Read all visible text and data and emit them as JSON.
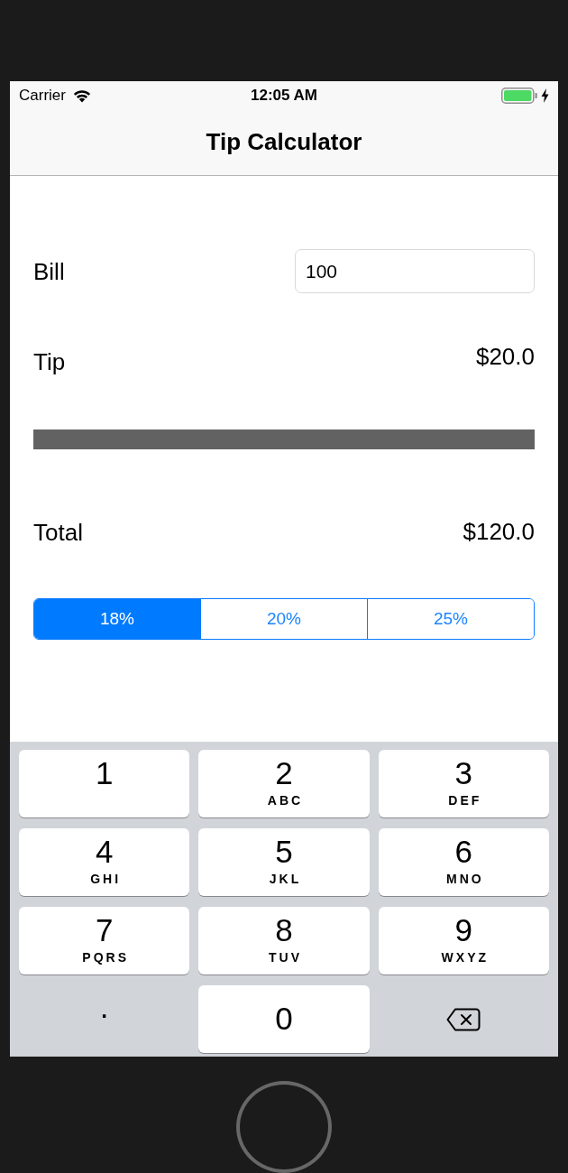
{
  "status_bar": {
    "carrier": "Carrier",
    "time": "12:05 AM",
    "charging": true
  },
  "nav_bar": {
    "title": "Tip Calculator"
  },
  "bill": {
    "label": "Bill",
    "value": "100"
  },
  "tip": {
    "label": "Tip",
    "amount": "$20.0"
  },
  "total": {
    "label": "Total",
    "amount": "$120.0"
  },
  "tip_options": [
    {
      "label": "18%",
      "selected": true
    },
    {
      "label": "20%",
      "selected": false
    },
    {
      "label": "25%",
      "selected": false
    }
  ],
  "keypad": [
    {
      "kind": "digit",
      "digit": "1"
    },
    {
      "kind": "digit",
      "digit": "2",
      "letters": "ABC"
    },
    {
      "kind": "digit",
      "digit": "3",
      "letters": "DEF"
    },
    {
      "kind": "digit",
      "digit": "4",
      "letters": "GHI"
    },
    {
      "kind": "digit",
      "digit": "5",
      "letters": "JKL"
    },
    {
      "kind": "digit",
      "digit": "6",
      "letters": "MNO"
    },
    {
      "kind": "digit",
      "digit": "7",
      "letters": "PQRS"
    },
    {
      "kind": "digit",
      "digit": "8",
      "letters": "TUV"
    },
    {
      "kind": "digit",
      "digit": "9",
      "letters": "WXYZ"
    },
    {
      "kind": "symbol",
      "digit": "."
    },
    {
      "kind": "plain",
      "digit": "0"
    },
    {
      "kind": "delete"
    }
  ]
}
